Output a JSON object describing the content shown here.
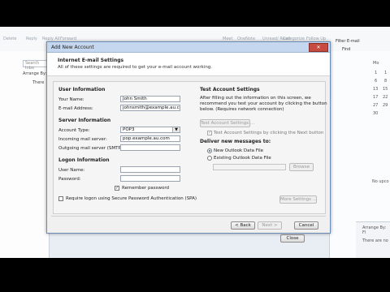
{
  "background": {
    "ribbon_items": [
      "Delete",
      "Reply",
      "Reply All",
      "Forward",
      "Meet",
      "OneNote",
      "Unread/ Read",
      "Categorize",
      "Follow Up",
      "Filter E-mail",
      "Find"
    ],
    "search_placeholder": "Search Inbo",
    "arrange_label": "Arrange By:",
    "there_text": "There",
    "calendar_rows": [
      "Mo",
      "1",
      "8",
      "15",
      "22",
      "29"
    ],
    "calendar_rows_2": [
      "1",
      "6",
      "13",
      "17",
      "27",
      "30"
    ],
    "no_upcoming": "No upco",
    "arrange_by_right": "Arrange By: Fl",
    "there_are_no": "There are no",
    "close_button": "Close"
  },
  "dialog": {
    "title": "Add New Account",
    "close_glyph": "✕",
    "header_title": "Internet E-mail Settings",
    "header_subtitle": "All of these settings are required to get your e-mail account working.",
    "user_info": {
      "heading": "User Information",
      "your_name_label": "Your Name:",
      "your_name_value": "John Smith",
      "email_label": "E-mail Address:",
      "email_value": "johnsmith@example.au.com"
    },
    "server_info": {
      "heading": "Server Information",
      "account_type_label": "Account Type:",
      "account_type_value": "POP3",
      "incoming_label": "Incoming mail server:",
      "incoming_value": "pop.example.au.com",
      "outgoing_label": "Outgoing mail server (SMTP):",
      "outgoing_value": ""
    },
    "logon_info": {
      "heading": "Logon Information",
      "user_name_label": "User Name:",
      "user_name_value": "",
      "password_label": "Password:",
      "password_value": "",
      "remember_label": "Remember password",
      "spa_label": "Require logon using Secure Password Authentication (SPA)"
    },
    "test_settings": {
      "heading": "Test Account Settings",
      "description_1": "After filling out the information on this screen, we",
      "description_2": "recommend you test your account by clicking the button",
      "description_3": "below. (Requires network connection)",
      "test_button": "Test Account Settings ...",
      "test_checkbox_label": "Test Account Settings by clicking the Next button"
    },
    "deliver": {
      "heading": "Deliver new messages to:",
      "option_new": "New Outlook Data File",
      "option_existing": "Existing Outlook Data File",
      "browse_button": "Browse"
    },
    "more_settings_button": "More Settings ...",
    "back_button": "< Back",
    "next_button": "Next >",
    "cancel_button": "Cancel"
  }
}
